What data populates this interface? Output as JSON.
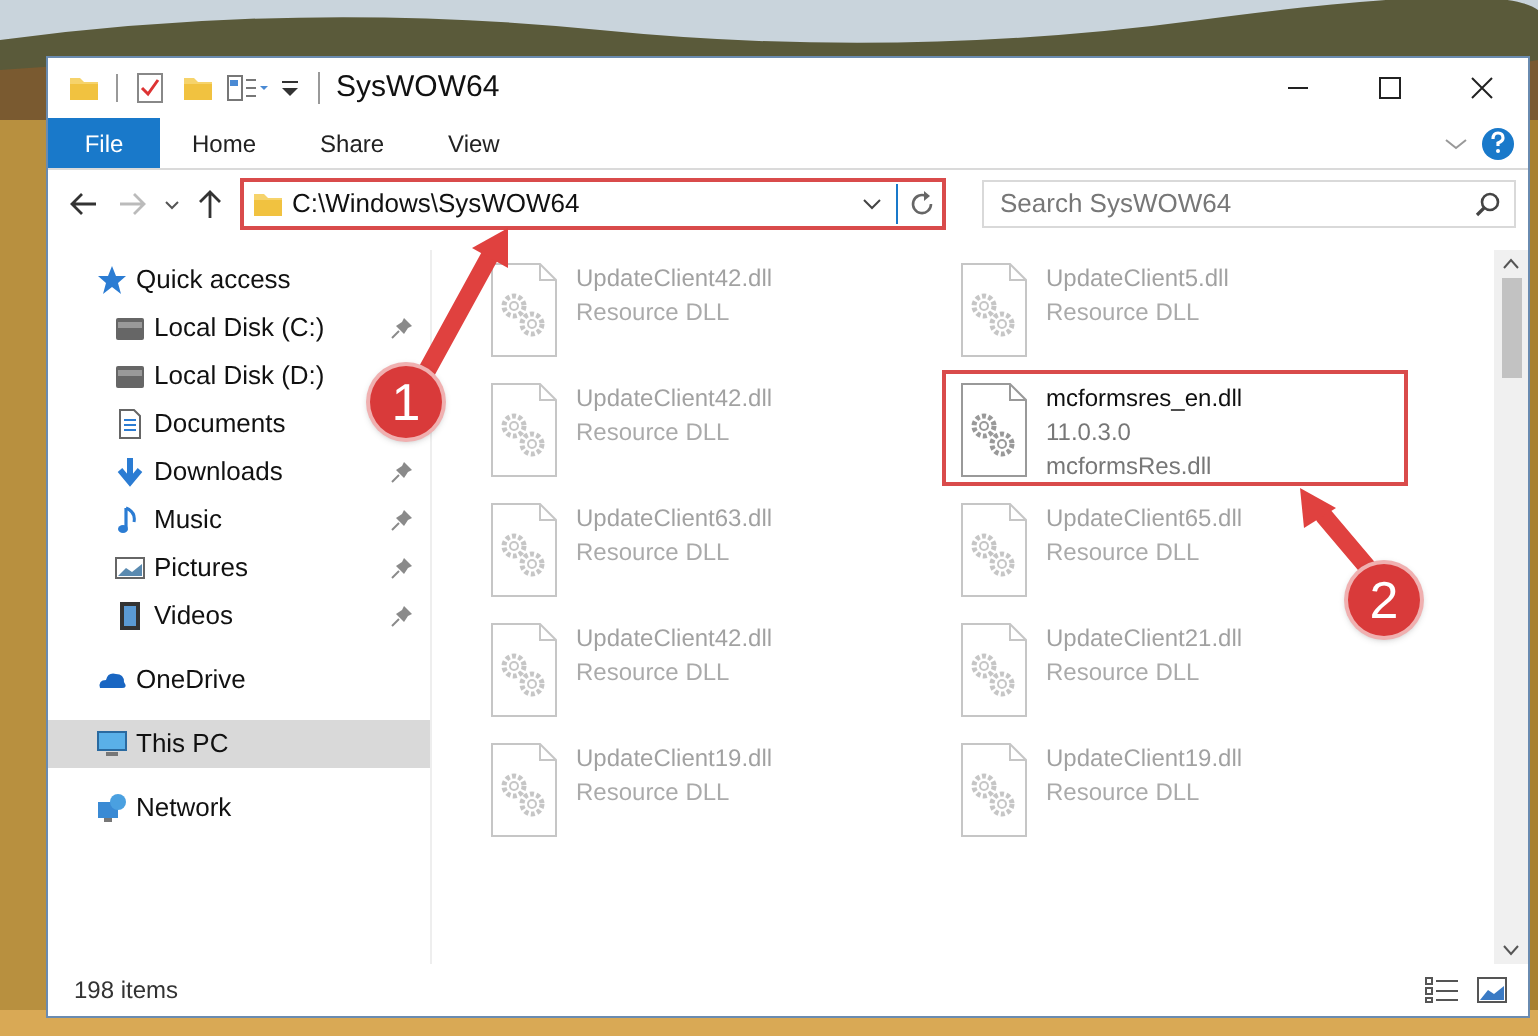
{
  "window": {
    "title": "SysWOW64"
  },
  "ribbon_tabs": [
    {
      "label": "File",
      "kind": "file"
    },
    {
      "label": "Home",
      "kind": "tab"
    },
    {
      "label": "Share",
      "kind": "tab"
    },
    {
      "label": "View",
      "kind": "tab"
    }
  ],
  "address": {
    "path": "C:\\Windows\\SysWOW64",
    "highlighted": true
  },
  "search": {
    "placeholder": "Search SysWOW64"
  },
  "nav": [
    {
      "label": "Quick access",
      "selected": false,
      "children": [
        {
          "label": "Local Disk (C:)",
          "pinned": true
        },
        {
          "label": "Local Disk (D:)",
          "pinned": false
        },
        {
          "label": "Documents",
          "pinned": false
        },
        {
          "label": "Downloads",
          "pinned": true
        },
        {
          "label": "Music",
          "pinned": true
        },
        {
          "label": "Pictures",
          "pinned": true
        },
        {
          "label": "Videos",
          "pinned": true
        }
      ]
    },
    {
      "label": "OneDrive",
      "selected": false
    },
    {
      "label": "This PC",
      "selected": true
    },
    {
      "label": "Network",
      "selected": false
    }
  ],
  "files": [
    {
      "name": "UpdateClient42.dll",
      "details": [
        "Resource DLL"
      ],
      "blurred": true,
      "highlighted": false
    },
    {
      "name": "UpdateClient5.dll",
      "details": [
        "Resource DLL"
      ],
      "blurred": true,
      "highlighted": false
    },
    {
      "name": "UpdateClient42.dll",
      "details": [
        "Resource DLL"
      ],
      "blurred": true,
      "highlighted": false
    },
    {
      "name": "mcformsres_en.dll",
      "details": [
        "11.0.3.0",
        "mcformsRes.dll"
      ],
      "blurred": false,
      "highlighted": true
    },
    {
      "name": "UpdateClient63.dll",
      "details": [
        "Resource DLL"
      ],
      "blurred": true,
      "highlighted": false
    },
    {
      "name": "UpdateClient65.dll",
      "details": [
        "Resource DLL"
      ],
      "blurred": true,
      "highlighted": false
    },
    {
      "name": "UpdateClient42.dll",
      "details": [
        "Resource DLL"
      ],
      "blurred": true,
      "highlighted": false
    },
    {
      "name": "UpdateClient21.dll",
      "details": [
        "Resource DLL"
      ],
      "blurred": true,
      "highlighted": false
    },
    {
      "name": "UpdateClient19.dll",
      "details": [
        "Resource DLL"
      ],
      "blurred": true,
      "highlighted": false
    },
    {
      "name": "UpdateClient19.dll",
      "details": [
        "Resource DLL"
      ],
      "blurred": true,
      "highlighted": false
    }
  ],
  "status_bar": {
    "count": "198 items"
  },
  "callouts": [
    {
      "number": "1"
    },
    {
      "number": "2"
    }
  ]
}
